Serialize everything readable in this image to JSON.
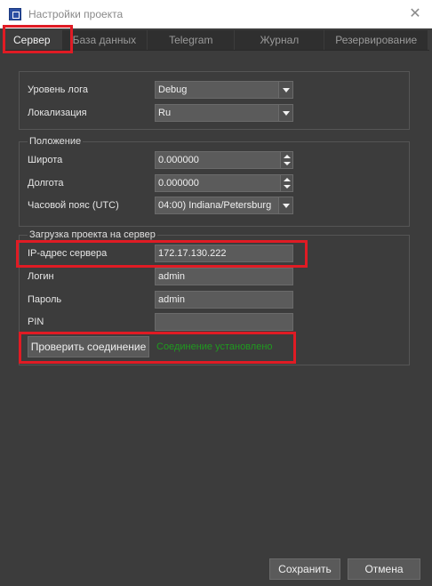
{
  "window": {
    "title": "Настройки проекта",
    "icon": "app-icon",
    "close": "✕"
  },
  "tabs": [
    {
      "label": "Сервер",
      "active": true
    },
    {
      "label": "База данных"
    },
    {
      "label": "Telegram"
    },
    {
      "label": "Журнал"
    },
    {
      "label": "Резервирование"
    }
  ],
  "general": {
    "log_level_label": "Уровень лога",
    "log_level_value": "Debug",
    "locale_label": "Локализация",
    "locale_value": "Ru"
  },
  "position": {
    "title": "Положение",
    "latitude_label": "Широта",
    "latitude_value": "0.000000",
    "longitude_label": "Долгота",
    "longitude_value": "0.000000",
    "timezone_label": "Часовой пояс (UTC)",
    "timezone_value": "04:00) Indiana/Petersburg"
  },
  "upload": {
    "title": "Загрузка проекта на сервер",
    "ip_label": "IP-адрес сервера",
    "ip_value": "172.17.130.222",
    "login_label": "Логин",
    "login_value": "admin",
    "password_label": "Пароль",
    "password_value": "admin",
    "pin_label": "PIN",
    "pin_value": "",
    "check_button": "Проверить соединение",
    "status": "Соединение установлено"
  },
  "footer": {
    "save": "Сохранить",
    "cancel": "Отмена"
  },
  "colors": {
    "highlight": "#e01b24",
    "status_ok": "#1f9a1f",
    "background": "#3c3c3c"
  }
}
